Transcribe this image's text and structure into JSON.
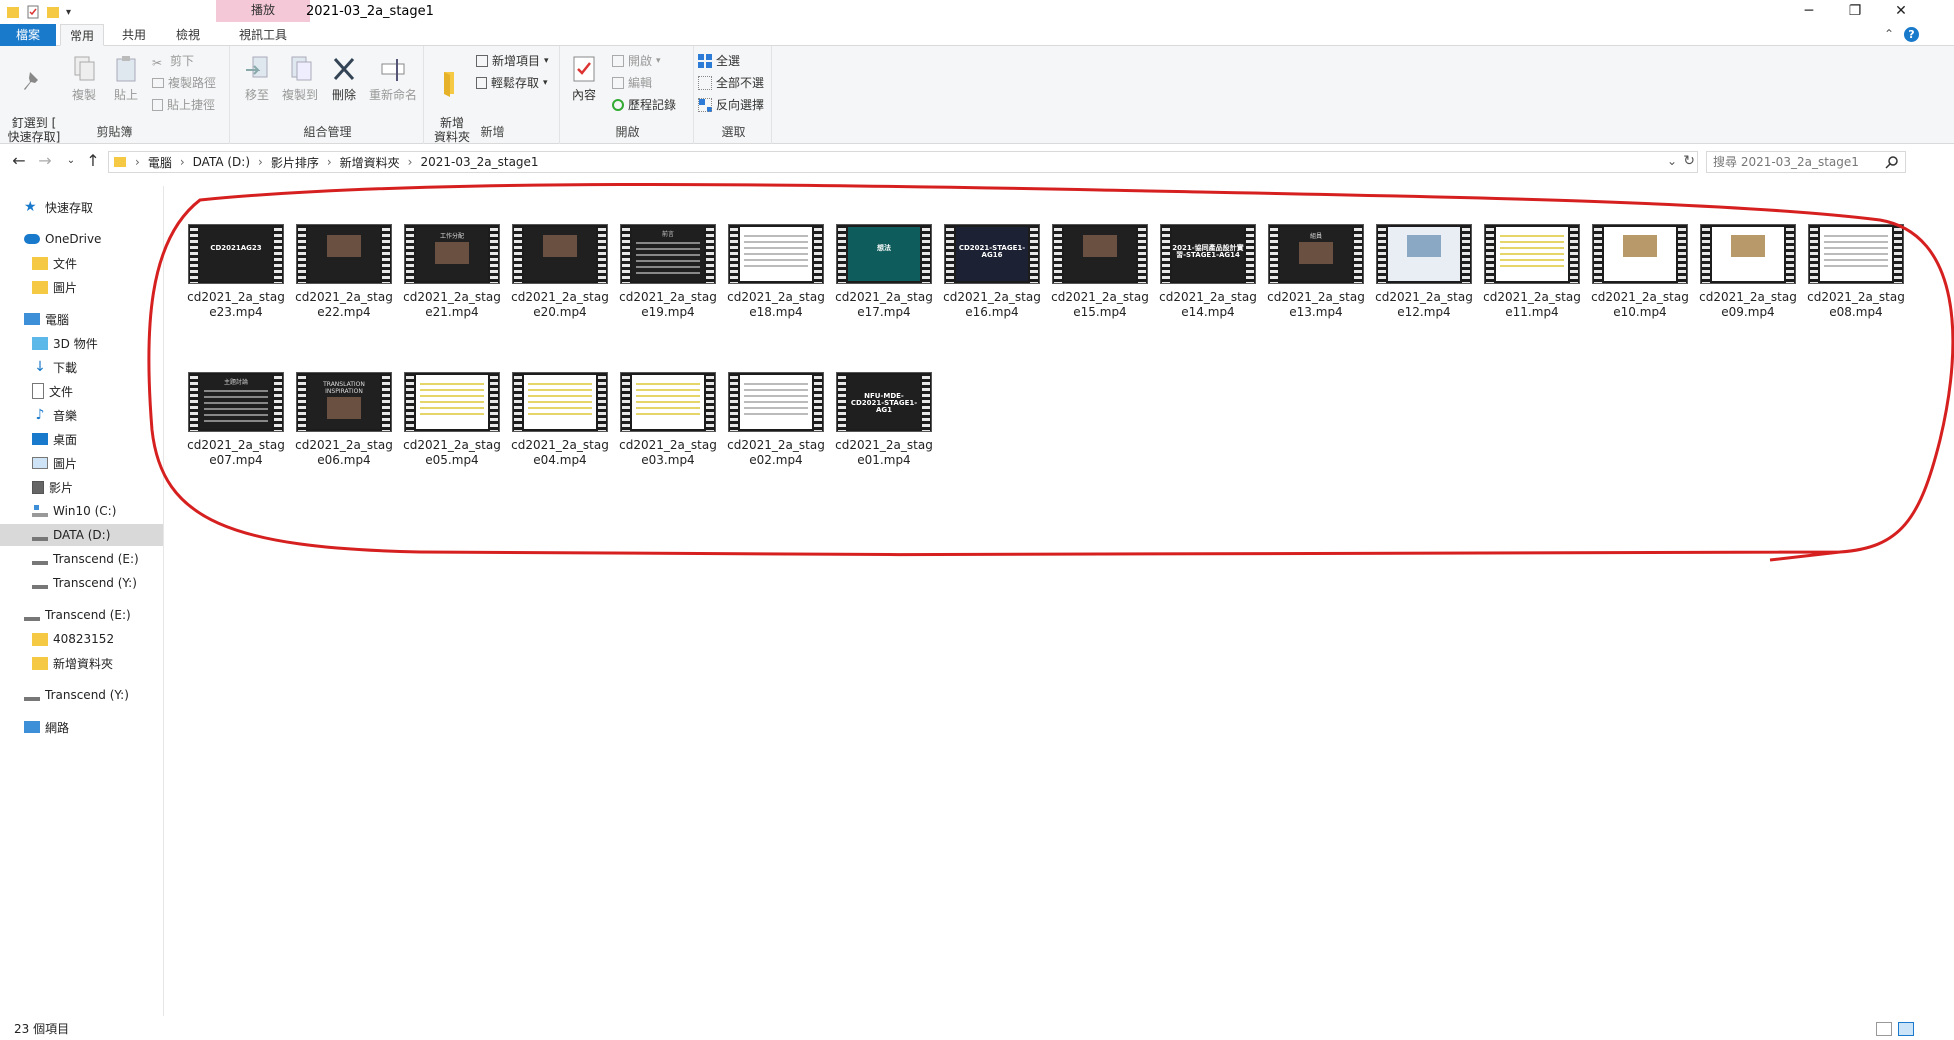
{
  "window": {
    "title": "2021-03_2a_stage1",
    "context_tab": "播放",
    "minimize": "─",
    "restore": "❐",
    "close": "✕"
  },
  "tabs": {
    "file": "檔案",
    "home": "常用",
    "share": "共用",
    "view": "檢視",
    "video_tools": "視訊工具"
  },
  "ribbon": {
    "clipboard": {
      "label": "剪貼簿",
      "pin": "釘選到 [\n快速存取]",
      "copy": "複製",
      "paste": "貼上",
      "cut": "剪下",
      "copy_path": "複製路徑",
      "paste_shortcut": "貼上捷徑"
    },
    "organize": {
      "label": "組合管理",
      "move_to": "移至",
      "copy_to": "複製到",
      "delete": "刪除",
      "rename": "重新命名"
    },
    "new": {
      "label": "新增",
      "new_folder": "新增\n資料夾",
      "new_item": "新增項目",
      "easy_access": "輕鬆存取"
    },
    "open": {
      "label": "開啟",
      "properties": "內容",
      "open": "開啟",
      "edit": "編輯",
      "history": "歷程記錄"
    },
    "select": {
      "label": "選取",
      "select_all": "全選",
      "select_none": "全部不選",
      "invert": "反向選擇"
    }
  },
  "address": {
    "crumbs": [
      "電腦",
      "DATA (D:)",
      "影片排序",
      "新增資料夾",
      "2021-03_2a_stage1"
    ],
    "search_placeholder": "搜尋 2021-03_2a_stage1"
  },
  "nav": {
    "items": [
      {
        "label": "快速存取",
        "icon": "star-icon"
      },
      {
        "label": "OneDrive",
        "icon": "cloud-icon"
      },
      {
        "label": "文件",
        "icon": "folder-icon"
      },
      {
        "label": "圖片",
        "icon": "folder-icon"
      },
      {
        "label": "電腦",
        "icon": "computer-icon"
      },
      {
        "label": "3D 物件",
        "icon": "cube-icon"
      },
      {
        "label": "下載",
        "icon": "download-icon"
      },
      {
        "label": "文件",
        "icon": "document-icon"
      },
      {
        "label": "音樂",
        "icon": "music-icon"
      },
      {
        "label": "桌面",
        "icon": "desktop-icon"
      },
      {
        "label": "圖片",
        "icon": "pictures-icon"
      },
      {
        "label": "影片",
        "icon": "video-icon"
      },
      {
        "label": "Win10 (C:)",
        "icon": "windows-drive-icon"
      },
      {
        "label": "DATA (D:)",
        "icon": "drive-icon"
      },
      {
        "label": "Transcend (E:)",
        "icon": "drive-icon"
      },
      {
        "label": "Transcend (Y:)",
        "icon": "drive-icon"
      },
      {
        "label": "Transcend (E:)",
        "icon": "drive-icon"
      },
      {
        "label": "40823152",
        "icon": "folder-icon"
      },
      {
        "label": "新增資料夾",
        "icon": "folder-icon"
      },
      {
        "label": "Transcend (Y:)",
        "icon": "drive-icon"
      },
      {
        "label": "網路",
        "icon": "network-icon"
      }
    ]
  },
  "files": [
    {
      "name": "cd2021_2a_stage23.mp4",
      "thumb_text": "CD2021AG23",
      "style": "dark"
    },
    {
      "name": "cd2021_2a_stage22.mp4",
      "thumb_text": "",
      "style": "dark-photo"
    },
    {
      "name": "cd2021_2a_stage21.mp4",
      "thumb_text": "工作分配",
      "style": "dark-photo"
    },
    {
      "name": "cd2021_2a_stage20.mp4",
      "thumb_text": "",
      "style": "dark-photo"
    },
    {
      "name": "cd2021_2a_stage19.mp4",
      "thumb_text": "前言",
      "style": "dark-text"
    },
    {
      "name": "cd2021_2a_stage18.mp4",
      "thumb_text": "",
      "style": "white"
    },
    {
      "name": "cd2021_2a_stage17.mp4",
      "thumb_text": "想法",
      "style": "teal"
    },
    {
      "name": "cd2021_2a_stage16.mp4",
      "thumb_text": "CD2021-STAGE1-AG16",
      "style": "navy"
    },
    {
      "name": "cd2021_2a_stage15.mp4",
      "thumb_text": "",
      "style": "dark-photo"
    },
    {
      "name": "cd2021_2a_stage14.mp4",
      "thumb_text": "2021-協同產品設計實習-STAGE1-AG14",
      "style": "dark"
    },
    {
      "name": "cd2021_2a_stage13.mp4",
      "thumb_text": "組員",
      "style": "dark-photo"
    },
    {
      "name": "cd2021_2a_stage12.mp4",
      "thumb_text": "",
      "style": "blue-photo"
    },
    {
      "name": "cd2021_2a_stage11.mp4",
      "thumb_text": "",
      "style": "yellow-text"
    },
    {
      "name": "cd2021_2a_stage10.mp4",
      "thumb_text": "",
      "style": "white-photo"
    },
    {
      "name": "cd2021_2a_stage09.mp4",
      "thumb_text": "",
      "style": "white-photo"
    },
    {
      "name": "cd2021_2a_stage08.mp4",
      "thumb_text": "",
      "style": "white"
    },
    {
      "name": "cd2021_2a_stage07.mp4",
      "thumb_text": "主題討論",
      "style": "dark-text"
    },
    {
      "name": "cd2021_2a_stage06.mp4",
      "thumb_text": "TRANSLATION INSPIRATION",
      "style": "dark-photo"
    },
    {
      "name": "cd2021_2a_stage05.mp4",
      "thumb_text": "",
      "style": "yellow-text"
    },
    {
      "name": "cd2021_2a_stage04.mp4",
      "thumb_text": "",
      "style": "yellow-text"
    },
    {
      "name": "cd2021_2a_stage03.mp4",
      "thumb_text": "",
      "style": "yellow-text"
    },
    {
      "name": "cd2021_2a_stage02.mp4",
      "thumb_text": "",
      "style": "white"
    },
    {
      "name": "cd2021_2a_stage01.mp4",
      "thumb_text": "NFU-MDE-CD2021-STAGE1-AG1",
      "style": "dark"
    }
  ],
  "status": {
    "count": "23 個項目"
  },
  "colors": {
    "accent": "#1979ca",
    "annotation": "#d62020",
    "context_tab": "#f5c8d8"
  }
}
